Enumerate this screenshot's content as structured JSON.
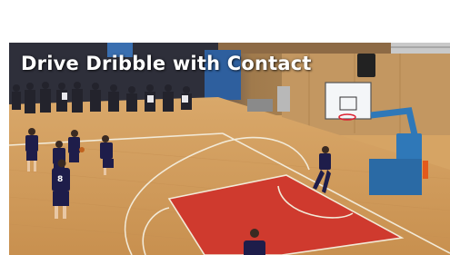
{
  "video_frame": {
    "caption": "Drive Dribble with Contact",
    "jersey_number": "8"
  },
  "colors": {
    "court_wood": "#d6a464",
    "paint_area": "#cf3a2e",
    "wall_wood": "#b98c55",
    "stands": "#2e2f3a",
    "backboard_support": "#2f78b8",
    "jersey": "#1e1d4a",
    "caption_text": "#ffffff"
  },
  "icons": [
    "basketball-hoop-icon",
    "scoreboard-speaker-icon"
  ]
}
